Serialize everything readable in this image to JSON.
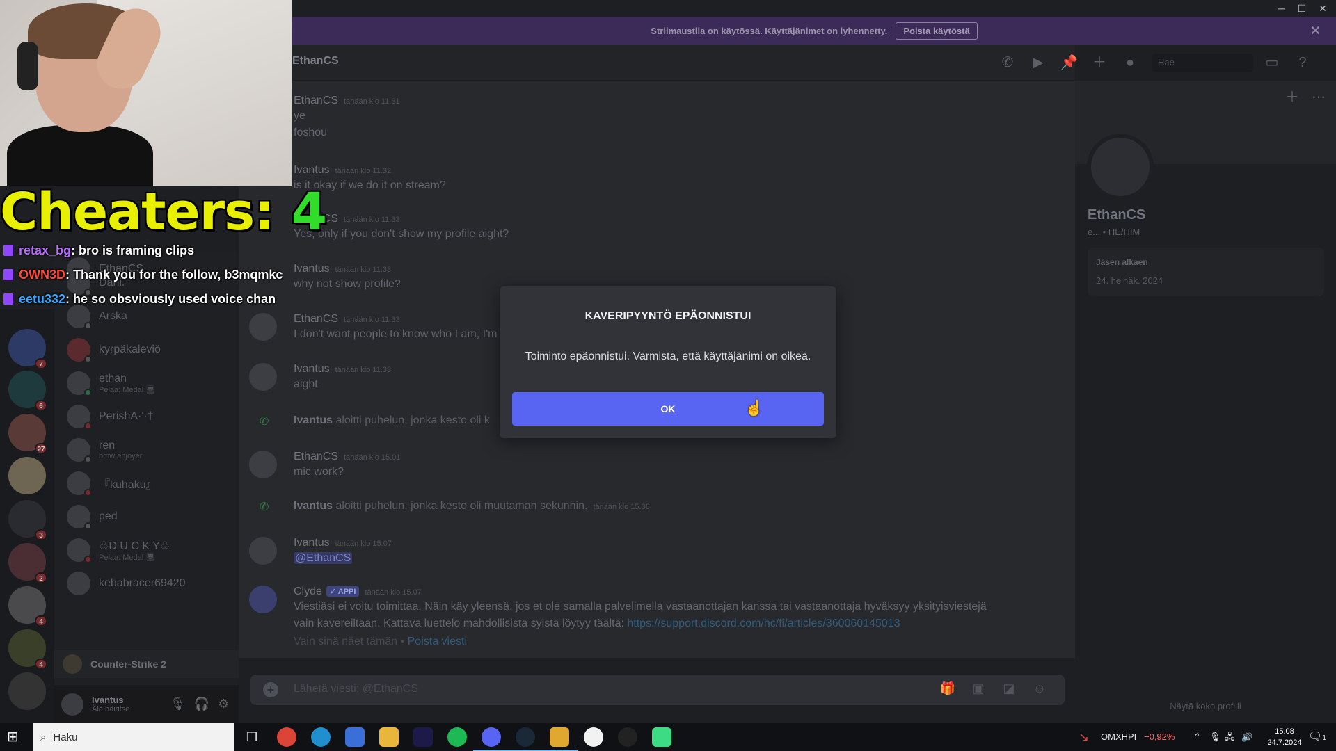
{
  "window": {
    "controls": [
      "─",
      "☐",
      "✕"
    ]
  },
  "banner": {
    "text": "Striimaustila on käytössä. Käyttäjänimet on lyhennetty.",
    "button": "Poista käytöstä"
  },
  "overlay": {
    "cheaters_label": "Cheaters:",
    "cheaters_count": "4",
    "chat": [
      {
        "user": "retax_bg",
        "color": "#b86bff",
        "text": ": bro is framing clips"
      },
      {
        "user": "OWN3D",
        "color": "#ff4a3a",
        "text": ": Thank you for the follow, b3mqmkc"
      },
      {
        "user": "eetu332",
        "color": "#3aa7ff",
        "text": ": he so obsviousIy used voice chan"
      }
    ]
  },
  "rail": {
    "badges": [
      "7",
      "6",
      "27",
      "",
      "3",
      "2",
      "4",
      "4"
    ]
  },
  "dms": [
    {
      "name": "EthanCS",
      "sub": ""
    },
    {
      "name": "Dani.",
      "sub": ""
    },
    {
      "name": "Arska",
      "sub": ""
    },
    {
      "name": "kyrpäkaleviö",
      "sub": ""
    },
    {
      "name": "ethan",
      "sub": "Pelaa: Medal 🖥"
    },
    {
      "name": "PerishA·'·†",
      "sub": ""
    },
    {
      "name": "ren",
      "sub": "bmw enjoyer"
    },
    {
      "name": "『kuhaku』",
      "sub": ""
    },
    {
      "name": "ped",
      "sub": ""
    },
    {
      "name": "♧D U C K Y♧",
      "sub": "Pelaa: Medal 🖥"
    },
    {
      "name": "kebabracer69420",
      "sub": ""
    }
  ],
  "activity": {
    "label": "Counter-Strike 2"
  },
  "user": {
    "name": "Ivantus",
    "status": "Älä häiritse"
  },
  "header": {
    "title": "EthanCS",
    "search_placeholder": "Hae"
  },
  "messages": {
    "m1": {
      "name": "EthanCS",
      "time": "tänään klo 11.31",
      "lines": [
        "ye",
        "foshou"
      ]
    },
    "m2": {
      "name": "Ivantus",
      "time": "tänään klo 11.32",
      "lines": [
        "is it okay if we do it on stream?"
      ]
    },
    "m3": {
      "name": "EthanCS",
      "time": "tänään klo 11.33",
      "lines": [
        "Yes, only if you don't show my profile aight?"
      ]
    },
    "m4": {
      "name": "Ivantus",
      "time": "tänään klo 11.33",
      "lines": [
        "why not show profile?"
      ]
    },
    "m5": {
      "name": "EthanCS",
      "time": "tänään klo 11.33",
      "lines": [
        "I don't want people to know who I am, I'm"
      ]
    },
    "m6": {
      "name": "Ivantus",
      "time": "tänään klo 11.33",
      "lines": [
        "aight"
      ]
    },
    "call1": {
      "name": "Ivantus",
      "text": " aloitti puhelun, jonka kesto oli k"
    },
    "m7": {
      "name": "EthanCS",
      "time": "tänään klo 15.01",
      "lines": [
        "mic work?"
      ]
    },
    "call2": {
      "name": "Ivantus",
      "text": " aloitti puhelun, jonka kesto oli muutaman sekunnin.",
      "time": "tänään klo 15.06"
    },
    "m8": {
      "name": "Ivantus",
      "time": "tänään klo 15.07",
      "mention": "@EthanCS"
    },
    "m9": {
      "name": "Clyde",
      "app": "✓ APPI",
      "time": "tänään klo 15.07",
      "line1": "Viestiäsi ei voitu toimittaa. Näin käy yleensä, jos et ole samalla palvelimella vastaanottajan kanssa tai vastaanottaja hyväksyy yksityisviestejä",
      "line2": "vain kavereiltaan. Kattava luettelo mahdollisista syistä löytyy täältä: ",
      "link": "https://support.discord.com/hc/fi/articles/360060145013",
      "hint": "Vain sinä näet tämän • ",
      "hint_link": "Poista viesti"
    }
  },
  "composer": {
    "placeholder": "Lähetä viesti: @EthanCS"
  },
  "profile": {
    "name": "EthanCS",
    "tag": "e... • HE/HIM",
    "member_since_label": "Jäsen alkaen",
    "member_since": "24. heinäk. 2024",
    "full_profile": "Näytä koko profiili"
  },
  "modal": {
    "title": "KAVERIPYYNTÖ EPÄONNISTUI",
    "body": "Toiminto epäonnistui. Varmista, että käyttäjänimi on oikea.",
    "ok": "OK"
  },
  "taskbar": {
    "search": "Haku",
    "stock_name": "OMXHPI",
    "stock_change": "−0,92%",
    "time": "15.08",
    "date": "24.7.2024",
    "notifications": "1"
  }
}
